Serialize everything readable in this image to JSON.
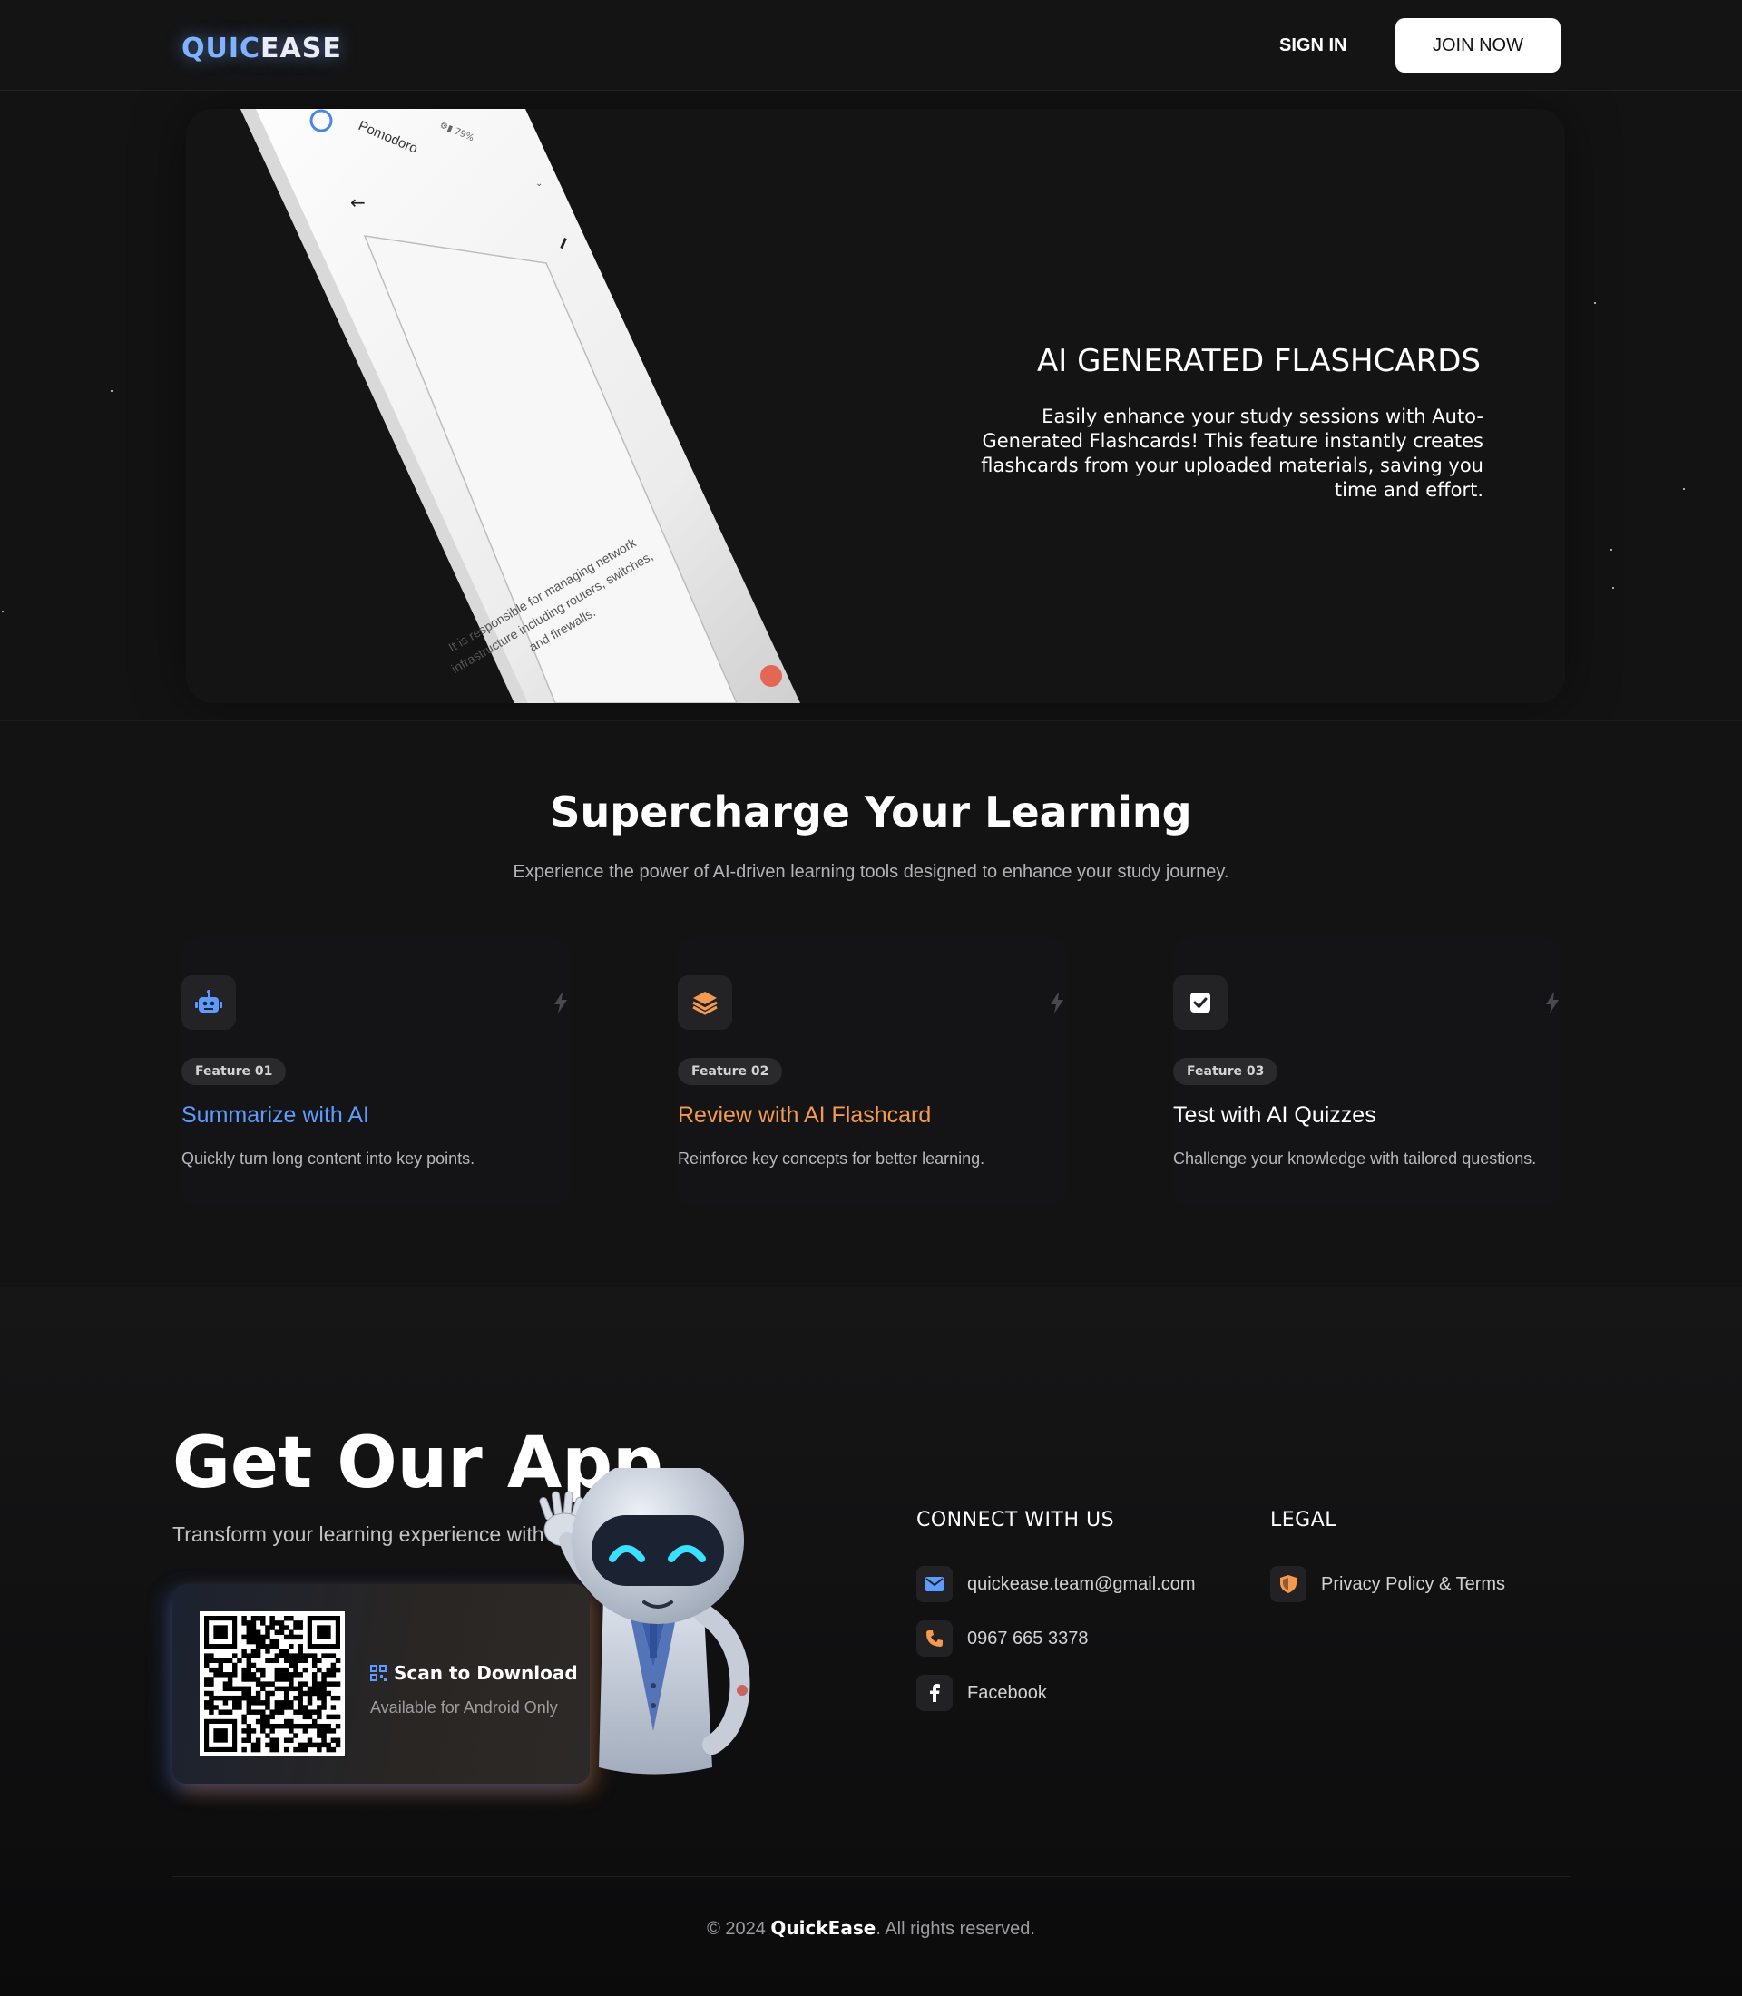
{
  "nav": {
    "logo_quick": "QUIC",
    "logo_ease": "EASE",
    "sign_in": "SIGN IN",
    "join_now": "JOIN NOW"
  },
  "hero": {
    "title": "AI GENERATED FLASHCARDS",
    "description": "Easily enhance your study sessions with Auto-Generated Flashcards! This feature instantly creates flashcards from your uploaded materials, saving you time and effort.",
    "phone": {
      "app_label": "Pomodoro",
      "card_text_line1": "It is responsible for managing network",
      "card_text_line2": "infrastructure including routers, switches,",
      "card_text_line3": "and firewalls."
    }
  },
  "features": {
    "title": "Supercharge Your Learning",
    "subtitle": "Experience the power of AI-driven learning tools designed to enhance your study journey.",
    "items": [
      {
        "badge": "Feature 01",
        "title": "Summarize with AI",
        "description": "Quickly turn long content into key points.",
        "icon": "robot-icon",
        "color": "#5e9bff"
      },
      {
        "badge": "Feature 02",
        "title": "Review with AI Flashcard",
        "description": "Reinforce key concepts for better learning.",
        "icon": "layers-icon",
        "color": "#f39a4e"
      },
      {
        "badge": "Feature 03",
        "title": "Test with AI Quizzes",
        "description": "Challenge your knowledge with tailored questions.",
        "icon": "check-square-icon",
        "color": "#ffffff"
      }
    ]
  },
  "app": {
    "title": "Get Our App",
    "subtitle": "Transform your learning experience with QuickEase",
    "scan_label": "Scan to Download",
    "availability": "Available for Android Only"
  },
  "connect": {
    "heading": "CONNECT WITH US",
    "email": "quickease.team@gmail.com",
    "phone": "0967 665 3378",
    "facebook": "Facebook"
  },
  "legal": {
    "heading": "LEGAL",
    "privacy": "Privacy Policy & Terms"
  },
  "footer": {
    "copyright_prefix": "© 2024",
    "brand": "QuickEase",
    "copyright_suffix": ". All rights reserved."
  },
  "colors": {
    "background": "#131314",
    "accent_blue": "#5e9bff",
    "accent_orange": "#f39a4e"
  }
}
